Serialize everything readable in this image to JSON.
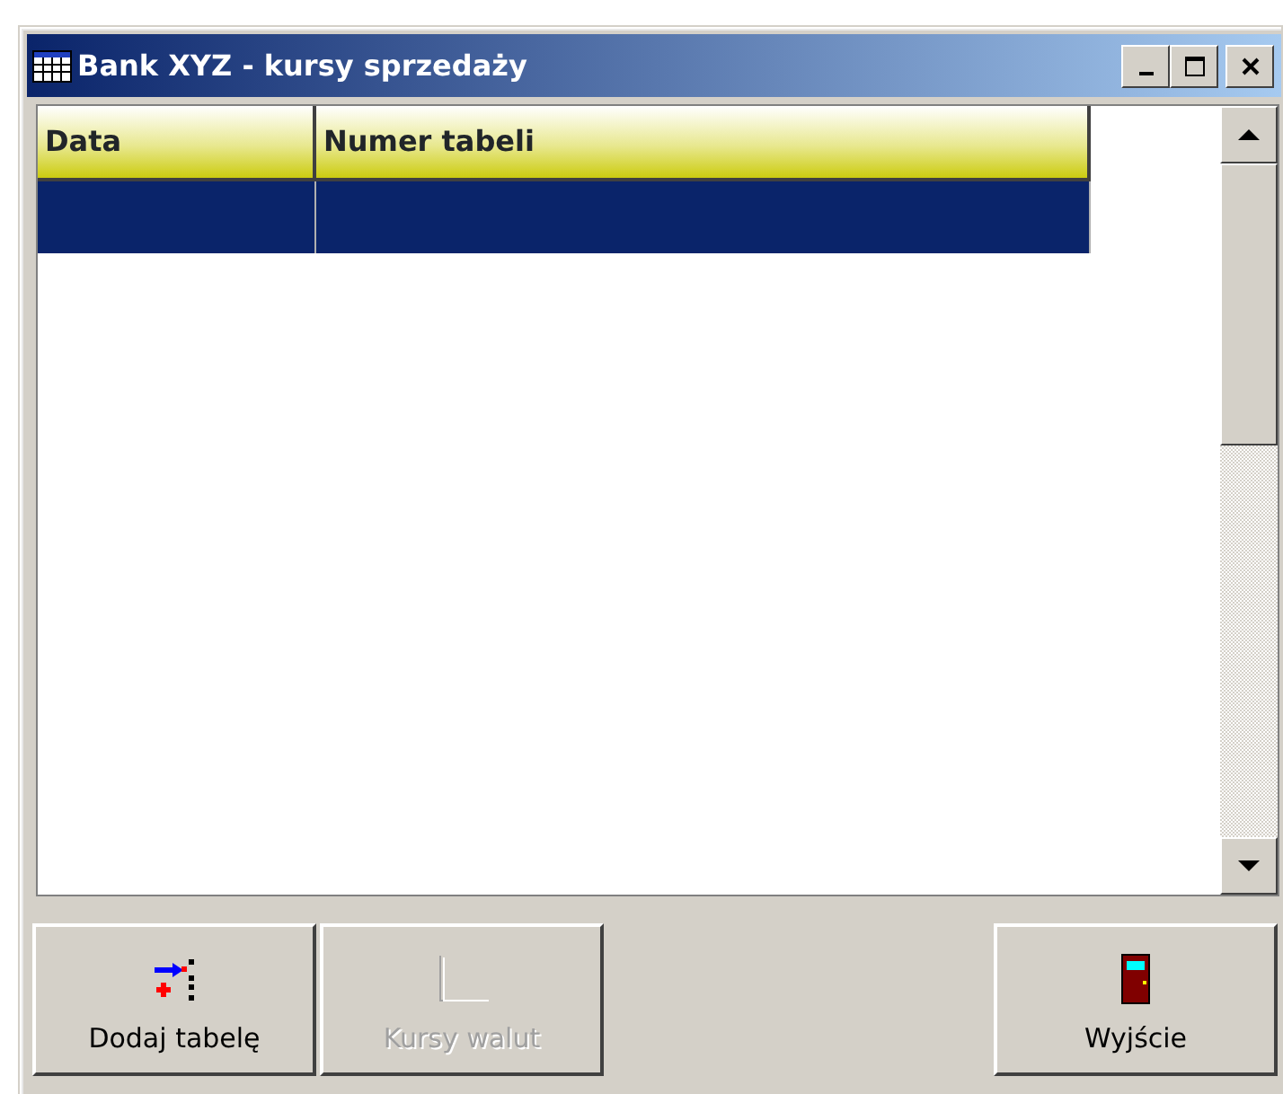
{
  "window": {
    "title": "Bank XYZ - kursy sprzedaży"
  },
  "table": {
    "columns": [
      "Data",
      "Numer tabeli"
    ],
    "rows": [
      {
        "cells": [
          "",
          ""
        ],
        "selected": true
      }
    ]
  },
  "buttons": [
    {
      "kind": "add",
      "label": "Dodaj tabelę",
      "disabled": false
    },
    {
      "kind": "rates",
      "label": "Kursy walut",
      "disabled": true
    },
    {
      "kind": "exit",
      "label": "Wyjście",
      "disabled": false
    }
  ]
}
